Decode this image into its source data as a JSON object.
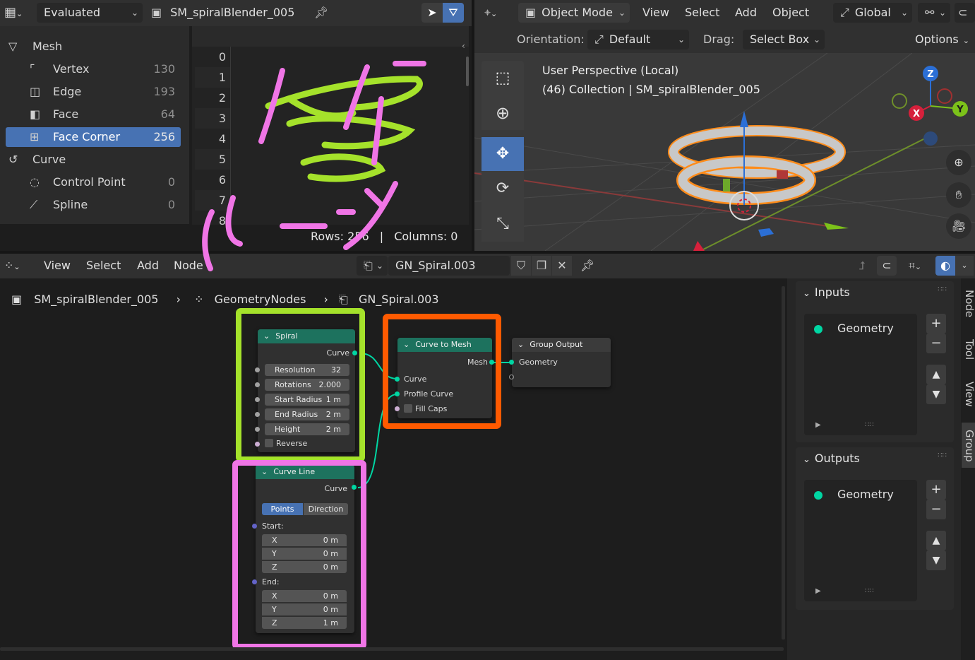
{
  "spreadsheet": {
    "display_mode": "Evaluated",
    "object_name": "SM_spiralBlender_005",
    "tree": [
      {
        "label": "Mesh",
        "count": "",
        "indent": 0,
        "icon": "mesh-icon"
      },
      {
        "label": "Vertex",
        "count": "130",
        "indent": 1,
        "icon": "vertex-icon"
      },
      {
        "label": "Edge",
        "count": "193",
        "indent": 1,
        "icon": "edge-icon"
      },
      {
        "label": "Face",
        "count": "64",
        "indent": 1,
        "icon": "face-icon"
      },
      {
        "label": "Face Corner",
        "count": "256",
        "indent": 1,
        "icon": "face-corner-icon",
        "selected": true
      },
      {
        "label": "Curve",
        "count": "",
        "indent": 0,
        "icon": "curve-icon"
      },
      {
        "label": "Control Point",
        "count": "0",
        "indent": 1,
        "icon": "control-point-icon"
      },
      {
        "label": "Spline",
        "count": "0",
        "indent": 1,
        "icon": "spline-icon"
      }
    ],
    "row_numbers": [
      "0",
      "1",
      "2",
      "3",
      "4",
      "5",
      "6",
      "7",
      "8"
    ],
    "rows_label": "Rows: 256",
    "columns_label": "Columns: 0",
    "overlay_text": "イメージ"
  },
  "viewport": {
    "mode": "Object Mode",
    "menu": [
      "View",
      "Select",
      "Add",
      "Object"
    ],
    "transform": "Global",
    "orientation_label": "Orientation:",
    "orientation_value": "Default",
    "drag_label": "Drag:",
    "drag_value": "Select Box",
    "options_label": "Options",
    "info_line1": "User Perspective (Local)",
    "info_line2": "(46) Collection | SM_spiralBlender_005",
    "gizmo": {
      "z": "Z",
      "x": "X",
      "y": "Y"
    }
  },
  "node_editor": {
    "menu": [
      "View",
      "Select",
      "Add",
      "Node"
    ],
    "tree_name": "GN_Spiral.003",
    "breadcrumb": [
      "SM_spiralBlender_005",
      "GeometryNodes",
      "GN_Spiral.003"
    ],
    "spiral_node": {
      "title": "Spiral",
      "output": "Curve",
      "fields": [
        {
          "label": "Resolution",
          "value": "32"
        },
        {
          "label": "Rotations",
          "value": "2.000"
        },
        {
          "label": "Start Radius",
          "value": "1 m"
        },
        {
          "label": "End Radius",
          "value": "2 m"
        },
        {
          "label": "Height",
          "value": "2 m"
        }
      ],
      "checkbox": "Reverse"
    },
    "curve_line_node": {
      "title": "Curve Line",
      "output": "Curve",
      "mode_active": "Points",
      "mode_other": "Direction",
      "start_label": "Start:",
      "end_label": "End:",
      "start": [
        {
          "label": "X",
          "value": "0 m"
        },
        {
          "label": "Y",
          "value": "0 m"
        },
        {
          "label": "Z",
          "value": "0 m"
        }
      ],
      "end": [
        {
          "label": "X",
          "value": "0 m"
        },
        {
          "label": "Y",
          "value": "0 m"
        },
        {
          "label": "Z",
          "value": "1 m"
        }
      ]
    },
    "curve_to_mesh_node": {
      "title": "Curve to Mesh",
      "output": "Mesh",
      "inputs": [
        "Curve",
        "Profile Curve"
      ],
      "checkbox": "Fill Caps"
    },
    "group_output_node": {
      "title": "Group Output",
      "input": "Geometry"
    },
    "side_panel": {
      "inputs_title": "Inputs",
      "outputs_title": "Outputs",
      "input_item": "Geometry",
      "output_item": "Geometry",
      "tabs": [
        "Node",
        "Tool",
        "View",
        "Group"
      ]
    }
  },
  "colors": {
    "accent_blue": "#4772b3",
    "node_geometry_header": "#1d725e",
    "socket_geometry": "#00d6a3",
    "annotation_green": "#a5e22b",
    "annotation_orange": "#ff5a00",
    "annotation_pink": "#f075e6"
  }
}
